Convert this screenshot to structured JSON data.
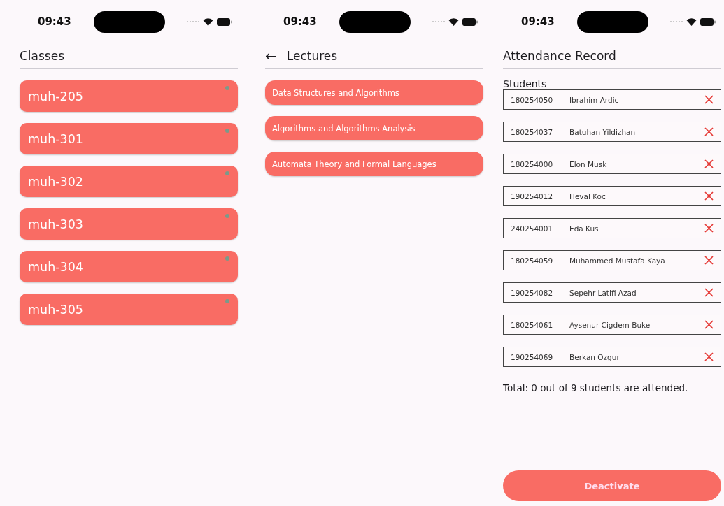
{
  "screens": [
    {
      "kind": "classes",
      "time": "09:43",
      "title": "Classes",
      "items": [
        "muh-205",
        "muh-301",
        "muh-302",
        "muh-303",
        "muh-304",
        "muh-305"
      ]
    },
    {
      "kind": "lectures",
      "time": "09:43",
      "back": "←",
      "title": "Lectures",
      "items": [
        "Data Structures and Algorithms",
        "Algorithms and Algorithms Analysis",
        "Automata Theory and Formal Languages"
      ]
    },
    {
      "kind": "attendance",
      "time": "09:43",
      "title": "Attendance Record",
      "section": "Students",
      "students": [
        {
          "id": "180254050",
          "name": "Ibrahim Ardic",
          "attended": false
        },
        {
          "id": "180254037",
          "name": "Batuhan Yildizhan",
          "attended": false
        },
        {
          "id": "180254000",
          "name": "Elon Musk",
          "attended": false
        },
        {
          "id": "190254012",
          "name": "Heval Koc",
          "attended": false
        },
        {
          "id": "240254001",
          "name": "Eda Kus",
          "attended": false
        },
        {
          "id": "180254059",
          "name": "Muhammed Mustafa Kaya",
          "attended": false
        },
        {
          "id": "190254082",
          "name": "Sepehr Latifi Azad",
          "attended": false
        },
        {
          "id": "180254061",
          "name": "Aysenur Cigdem Buke",
          "attended": false
        },
        {
          "id": "190254069",
          "name": "Berkan Ozgur",
          "attended": false
        }
      ],
      "total": "Total: 0 out of 9 students are attended.",
      "button": "Deactivate"
    }
  ]
}
